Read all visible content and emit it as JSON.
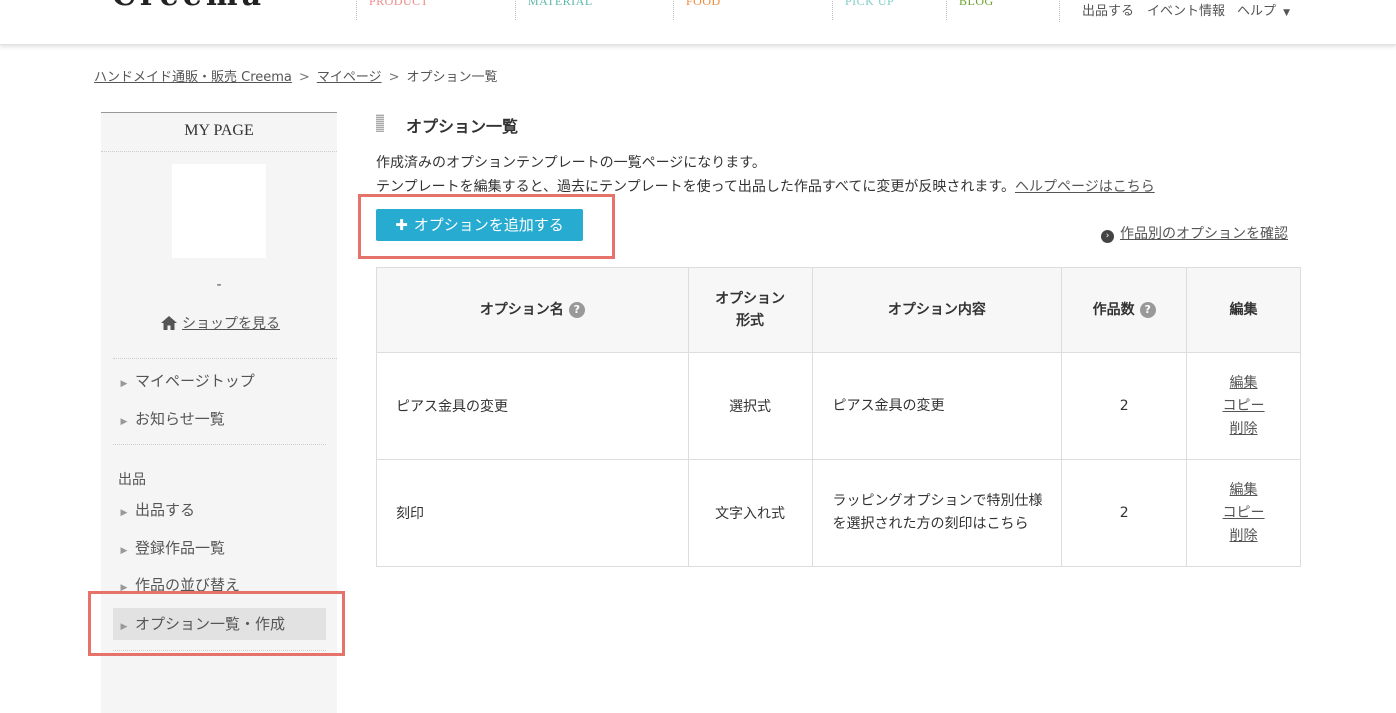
{
  "header": {
    "logo": "Creema",
    "categories": [
      {
        "label": "PRODUCT",
        "color": "#ee8a8a"
      },
      {
        "label": "MATERIAL",
        "color": "#5fb8a8"
      },
      {
        "label": "FOOD",
        "color": "#f08a3c"
      },
      {
        "label": "PICK UP",
        "color": "#7fd0c8"
      },
      {
        "label": "BLOG",
        "color": "#6aa22a"
      }
    ],
    "util_links": {
      "sell": "出品する",
      "events": "イベント情報",
      "help": "ヘルプ"
    }
  },
  "breadcrumb": {
    "items": [
      "ハンドメイド通販・販売 Creema",
      "マイページ",
      "オプション一覧"
    ],
    "separator": ">"
  },
  "sidebar": {
    "title": "MY PAGE",
    "shop_name": "-",
    "view_shop": "ショップを見る",
    "items": [
      {
        "label": "マイページトップ"
      },
      {
        "label": "お知らせ一覧"
      },
      {
        "label": "出品する"
      },
      {
        "label": "登録作品一覧"
      },
      {
        "label": "作品の並び替え"
      },
      {
        "label": "オプション一覧・作成"
      }
    ],
    "section_listing": "出品"
  },
  "main": {
    "title": "オプション一覧",
    "description_line1": "作成済みのオプションテンプレートの一覧ページになります。",
    "description_line2": "テンプレートを編集すると、過去にテンプレートを使って出品した作品すべてに変更が反映されます。",
    "help_link": "ヘルプページはこちら",
    "add_button": "オプションを追加する",
    "check_link": "作品別のオプションを確認"
  },
  "table": {
    "headers": {
      "name": "オプション名",
      "type_line1": "オプション",
      "type_line2": "形式",
      "content": "オプション内容",
      "count": "作品数",
      "edit": "編集"
    },
    "rows": [
      {
        "name": "ピアス金具の変更",
        "type": "選択式",
        "content": "ピアス金具の変更",
        "count": "2",
        "actions": {
          "edit": "編集",
          "copy": "コピー",
          "delete": "削除"
        }
      },
      {
        "name": "刻印",
        "type": "文字入れ式",
        "content": "ラッピングオプションで特別仕様を選択された方の刻印はこちら",
        "count": "2",
        "actions": {
          "edit": "編集",
          "copy": "コピー",
          "delete": "削除"
        }
      }
    ]
  },
  "colors": {
    "accent_button": "#27abd0",
    "highlight_box": "#e5736a"
  }
}
